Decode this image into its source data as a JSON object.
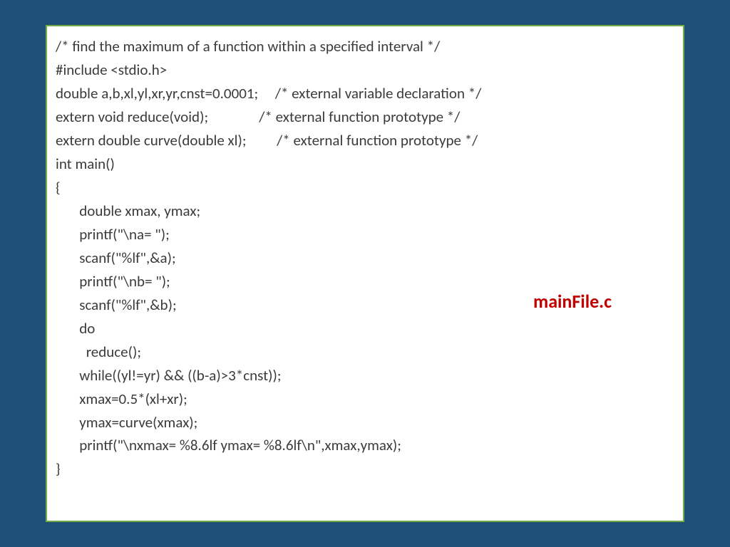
{
  "code_lines": [
    "/* find the maximum of a function within a specified interval */",
    "#include <stdio.h>",
    "double a,b,xl,yl,xr,yr,cnst=0.0001;     /* external variable declaration */",
    "extern void reduce(void);               /* external function prototype */",
    "extern double curve(double xl);         /* external function prototype */",
    "int main()",
    "{",
    "       double xmax, ymax;",
    "       printf(\"\\na= \");",
    "       scanf(\"%lf\",&a);",
    "       printf(\"\\nb= \");",
    "       scanf(\"%lf\",&b);",
    "       do",
    "         reduce();",
    "       while((yl!=yr) && ((b-a)>3*cnst));",
    "       xmax=0.5*(xl+xr);",
    "       ymax=curve(xmax);",
    "       printf(\"\\nxmax= %8.6lf ymax= %8.6lf\\n\",xmax,ymax);",
    "}"
  ],
  "filename_label": "mainFile.c"
}
